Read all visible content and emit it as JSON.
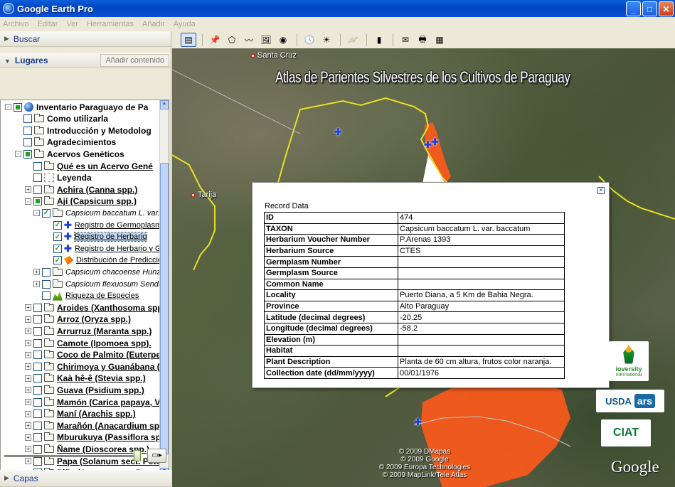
{
  "window": {
    "title": "Google Earth Pro"
  },
  "menu": [
    "Archivo",
    "Editar",
    "Ver",
    "Herramientas",
    "Añadir",
    "Ayuda"
  ],
  "panels": {
    "buscar": "Buscar",
    "lugares": "Lugares",
    "add_content": "Añadir contenido",
    "capas": "Capas"
  },
  "tree": [
    {
      "label": "Inventario Paraguayo de Pa",
      "indent": 0,
      "exp": "-",
      "chk": "part",
      "icon": "globe",
      "style": "bold"
    },
    {
      "label": "Como utilizarla",
      "indent": 1,
      "exp": "",
      "chk": "",
      "icon": "folder",
      "style": "bold"
    },
    {
      "label": "Introducción y Metodolog",
      "indent": 1,
      "exp": "",
      "chk": "",
      "icon": "folder",
      "style": "bold"
    },
    {
      "label": "Agradecimientos",
      "indent": 1,
      "exp": "",
      "chk": "",
      "icon": "folder",
      "style": "bold"
    },
    {
      "label": "Acervos Genéticos",
      "indent": 1,
      "exp": "-",
      "chk": "part",
      "icon": "folder-open",
      "style": "bold"
    },
    {
      "label": "Qué es un Acervo Gené",
      "indent": 2,
      "exp": "",
      "chk": "",
      "icon": "folder",
      "style": "bold ul"
    },
    {
      "label": "Leyenda",
      "indent": 2,
      "exp": "",
      "chk": "",
      "icon": "legend",
      "style": "bold"
    },
    {
      "label": "Achira (Canna spp.)",
      "indent": 2,
      "exp": "+",
      "chk": "",
      "icon": "folder",
      "style": "bold ul"
    },
    {
      "label": "Ají (Capsicum spp.)",
      "indent": 2,
      "exp": "-",
      "chk": "part",
      "icon": "folder-open",
      "style": "bold ul"
    },
    {
      "label": "Capsicum baccatum L. var.",
      "indent": 3,
      "exp": "-",
      "chk": "check",
      "icon": "folder-open",
      "style": "it small"
    },
    {
      "label": "Registro de Germoplasma",
      "indent": 4,
      "exp": "",
      "chk": "check",
      "icon": "pin",
      "style": "ul small"
    },
    {
      "label": "Registro de Herbario",
      "indent": 4,
      "exp": "",
      "chk": "check",
      "icon": "pin",
      "style": "ul small sel"
    },
    {
      "label": "Registro de Herbario y Ger",
      "indent": 4,
      "exp": "",
      "chk": "check",
      "icon": "pin",
      "style": "ul small"
    },
    {
      "label": "Distribución de Predicción",
      "indent": 4,
      "exp": "",
      "chk": "check",
      "icon": "poly",
      "style": "ul small"
    },
    {
      "label": "Capsicum chacoense Hunz.",
      "indent": 3,
      "exp": "+",
      "chk": "",
      "icon": "folder",
      "style": "it small"
    },
    {
      "label": "Capsicum flexuosum Sendtn.",
      "indent": 3,
      "exp": "+",
      "chk": "",
      "icon": "folder",
      "style": "it small"
    },
    {
      "label": "Riqueza de Especies",
      "indent": 3,
      "exp": "",
      "chk": "",
      "icon": "plant",
      "style": "ul small"
    },
    {
      "label": "Aroides (Xanthosoma spp.)",
      "indent": 2,
      "exp": "+",
      "chk": "",
      "icon": "folder",
      "style": "bold ul"
    },
    {
      "label": "Arroz (Oryza spp.)",
      "indent": 2,
      "exp": "+",
      "chk": "",
      "icon": "folder",
      "style": "bold ul"
    },
    {
      "label": "Arrurruz (Maranta spp.)",
      "indent": 2,
      "exp": "+",
      "chk": "",
      "icon": "folder",
      "style": "bold ul"
    },
    {
      "label": "Camote (Ipomoea spp).",
      "indent": 2,
      "exp": "+",
      "chk": "",
      "icon": "folder",
      "style": "bold ul"
    },
    {
      "label": "Coco de Palmito (Euterpe s",
      "indent": 2,
      "exp": "+",
      "chk": "",
      "icon": "folder",
      "style": "bold ul"
    },
    {
      "label": "Chirimoya y Guanábana (A",
      "indent": 2,
      "exp": "+",
      "chk": "",
      "icon": "folder",
      "style": "bold ul"
    },
    {
      "label": "Kaà hê-ê (Stevia spp.)",
      "indent": 2,
      "exp": "+",
      "chk": "",
      "icon": "folder",
      "style": "bold ul"
    },
    {
      "label": "Guava (Psidium spp.)",
      "indent": 2,
      "exp": "+",
      "chk": "",
      "icon": "folder",
      "style": "bold ul"
    },
    {
      "label": "Mamón (Carica papaya, Va",
      "indent": 2,
      "exp": "+",
      "chk": "",
      "icon": "folder",
      "style": "bold ul"
    },
    {
      "label": "Maní (Arachis spp.)",
      "indent": 2,
      "exp": "+",
      "chk": "",
      "icon": "folder",
      "style": "bold ul"
    },
    {
      "label": "Marañón (Anacardium spp.",
      "indent": 2,
      "exp": "+",
      "chk": "",
      "icon": "folder",
      "style": "bold ul"
    },
    {
      "label": "Mburukuya (Passiflora spp",
      "indent": 2,
      "exp": "+",
      "chk": "",
      "icon": "folder",
      "style": "bold ul"
    },
    {
      "label": "Ñame (Dioscorea spp.)",
      "indent": 2,
      "exp": "+",
      "chk": "",
      "icon": "folder",
      "style": "bold ul"
    },
    {
      "label": "Papa (Solanum sect. Petot",
      "indent": 2,
      "exp": "+",
      "chk": "",
      "icon": "folder",
      "style": "bold ul"
    },
    {
      "label": "Piña (Ananas spp., Pseuda",
      "indent": 2,
      "exp": "+",
      "chk": "",
      "icon": "folder",
      "style": "bold ul"
    }
  ],
  "toolbar_icons": [
    "sidebar-toggle-icon",
    "placemark-icon",
    "polygon-icon",
    "path-icon",
    "image-overlay-icon",
    "tour-icon",
    "historical-imagery-icon",
    "sunlight-icon",
    "planets-icon",
    "ruler-icon",
    "email-icon",
    "print-icon",
    "view-in-maps-icon"
  ],
  "map": {
    "overlay_title": "Atlas de Parientes Silvestres de los Cultivos de Paraguay",
    "cities": [
      {
        "name": "Santa Cruz"
      },
      {
        "name": "Tarija"
      }
    ],
    "credits": [
      "© 2009 DMapas",
      "© 2009 Google",
      "© 2009 Europa Technologies",
      "© 2009 MapLink/Tele Atlas"
    ],
    "google_logo": "Google",
    "logos": {
      "bioversity": "ioversity",
      "bioversity_sub": "nternational",
      "usda": "USDA",
      "ars": "ars",
      "ciat": "CIAT"
    }
  },
  "record": {
    "title": "Record Data",
    "rows": [
      [
        "ID",
        "474"
      ],
      [
        "TAXON",
        "Capsicum baccatum L. var. baccatum"
      ],
      [
        "Herbarium Voucher Number",
        "P.Arenas 1393"
      ],
      [
        "Herbarium Source",
        "CTES"
      ],
      [
        "Germplasm Number",
        ""
      ],
      [
        "Germplasm Source",
        ""
      ],
      [
        "Common Name",
        ""
      ],
      [
        "Locality",
        "Puerto Diana, a 5 Km de Bahia Negra."
      ],
      [
        "Province",
        "Alto Paraguay"
      ],
      [
        "Latitude (decimal degrees)",
        "-20.25"
      ],
      [
        "Longitude (decimal degrees)",
        "-58.2"
      ],
      [
        "Elevation (m)",
        ""
      ],
      [
        "Habitat",
        ""
      ],
      [
        "Plant Description",
        "Planta de 60 cm altura, frutos color naranja."
      ],
      [
        "Collection date (dd/mm/yyyy)",
        "00/01/1976"
      ]
    ]
  },
  "colors": {
    "border_line": "#e8e020",
    "prediction_fill": "#ff5a1a",
    "pin": "#2040e0"
  }
}
